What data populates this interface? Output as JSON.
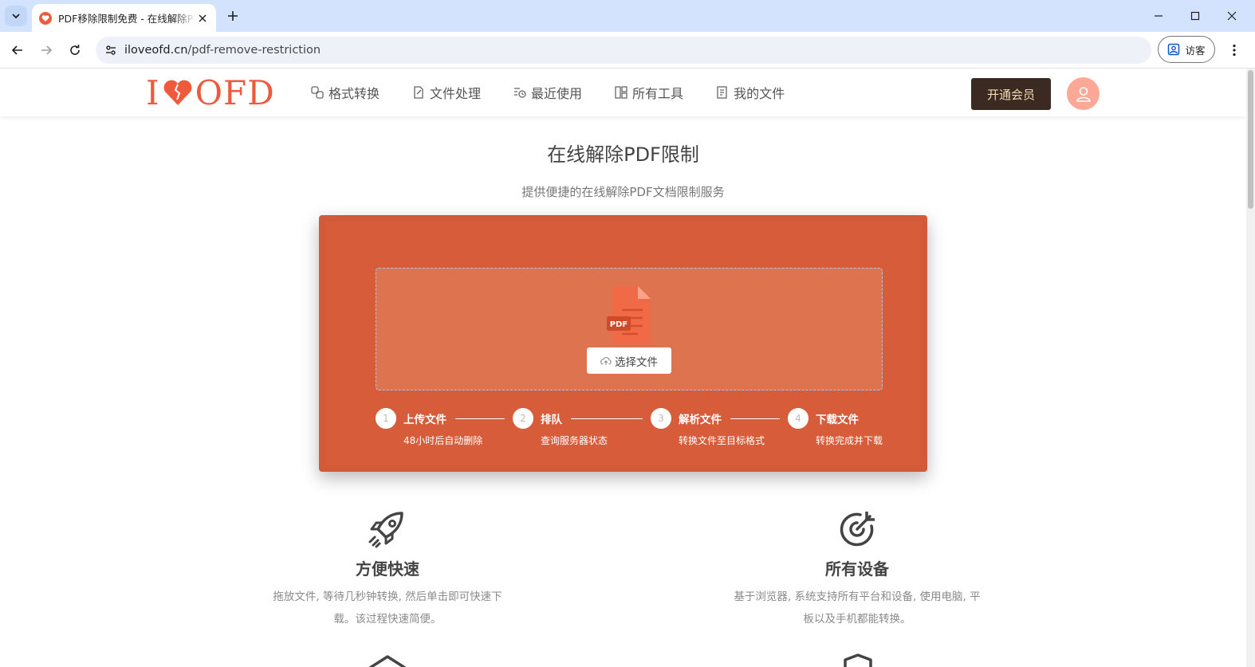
{
  "browser": {
    "tab_title": "PDF移除限制免费 - 在线解除PDF限制",
    "url_domain": "iloveofd.cn",
    "url_path": "/pdf-remove-restriction",
    "profile_label": "访客"
  },
  "site": {
    "logo_left": "I",
    "logo_right": "OFD",
    "nav": [
      {
        "label": "格式转换",
        "icon": "convert-icon"
      },
      {
        "label": "文件处理",
        "icon": "file-edit-icon"
      },
      {
        "label": "最近使用",
        "icon": "recent-icon"
      },
      {
        "label": "所有工具",
        "icon": "grid-icon"
      },
      {
        "label": "我的文件",
        "icon": "my-files-icon"
      }
    ],
    "vip_label": "开通会员"
  },
  "hero": {
    "title": "在线解除PDF限制",
    "subtitle": "提供便捷的在线解除PDF文档限制服务"
  },
  "upload": {
    "file_badge": "PDF",
    "select_label": "选择文件"
  },
  "steps": [
    {
      "num": "1",
      "title": "上传文件",
      "desc": "48小时后自动删除"
    },
    {
      "num": "2",
      "title": "排队",
      "desc": "查询服务器状态"
    },
    {
      "num": "3",
      "title": "解析文件",
      "desc": "转换文件至目标格式"
    },
    {
      "num": "4",
      "title": "下载文件",
      "desc": "转换完成并下载"
    }
  ],
  "features": [
    {
      "title": "方便快速",
      "desc_line1": "拖放文件, 等待几秒钟转换, 然后单击即可快速下",
      "desc_line2": "载。该过程快速简便。",
      "icon": "rocket-icon"
    },
    {
      "title": "所有设备",
      "desc_line1": "基于浏览器, 系统支持所有平台和设备, 使用电脑, 平",
      "desc_line2": "板以及手机都能转换。",
      "icon": "target-icon"
    }
  ],
  "colors": {
    "brand": "#ef5a3c",
    "card": "#d35a38",
    "dropzone": "#de7350",
    "vip_bg": "#3b2a22"
  }
}
